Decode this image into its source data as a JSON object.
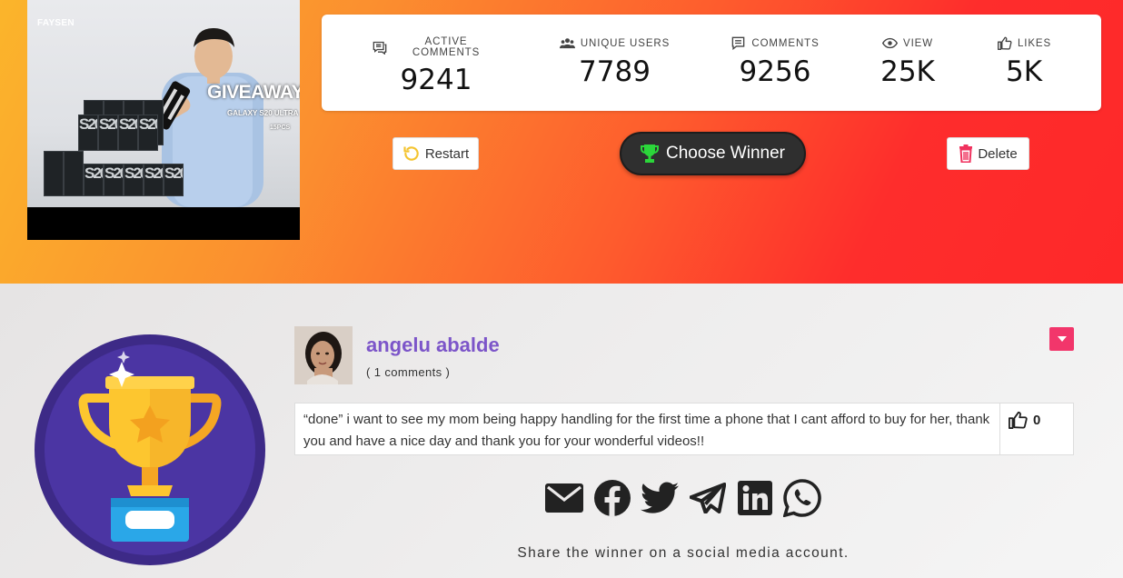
{
  "video": {
    "channel": "FAYSEN",
    "title": "GIVEAWAY",
    "subtitle": "GALAXY S20 ULTRA",
    "quantity": "15PCS",
    "box_label": "S20"
  },
  "stats": [
    {
      "label": "Active comments",
      "value": "9241",
      "icon": "comments-icon"
    },
    {
      "label": "Unique users",
      "value": "7789",
      "icon": "users-icon"
    },
    {
      "label": "Comments",
      "value": "9256",
      "icon": "comment-icon"
    },
    {
      "label": "View",
      "value": "25K",
      "icon": "eye-icon"
    },
    {
      "label": "Likes",
      "value": "5K",
      "icon": "thumbs-up-icon"
    }
  ],
  "actions": {
    "restart_label": "Restart",
    "choose_winner_label": "Choose Winner",
    "delete_label": "Delete"
  },
  "winner": {
    "name": "angelu abalde",
    "comment_count": "( 1 comments )",
    "comment": "“done” i want to see my mom being happy handling for the first time a phone that I cant afford to buy for her, thank you and have a nice day and thank you for your wonderful videos!!",
    "likes": "0"
  },
  "share": {
    "caption": "Share the winner on a social media account.",
    "networks": [
      "email-icon",
      "facebook-icon",
      "twitter-icon",
      "telegram-icon",
      "linkedin-icon",
      "whatsapp-icon"
    ]
  },
  "colors": {
    "winner_name": "#7c55c9",
    "dropdown": "#f2366b",
    "trophy_circle": "#3d2a87",
    "trophy_gold": "#fdc62f",
    "choose_button": "#2f2f2f"
  }
}
